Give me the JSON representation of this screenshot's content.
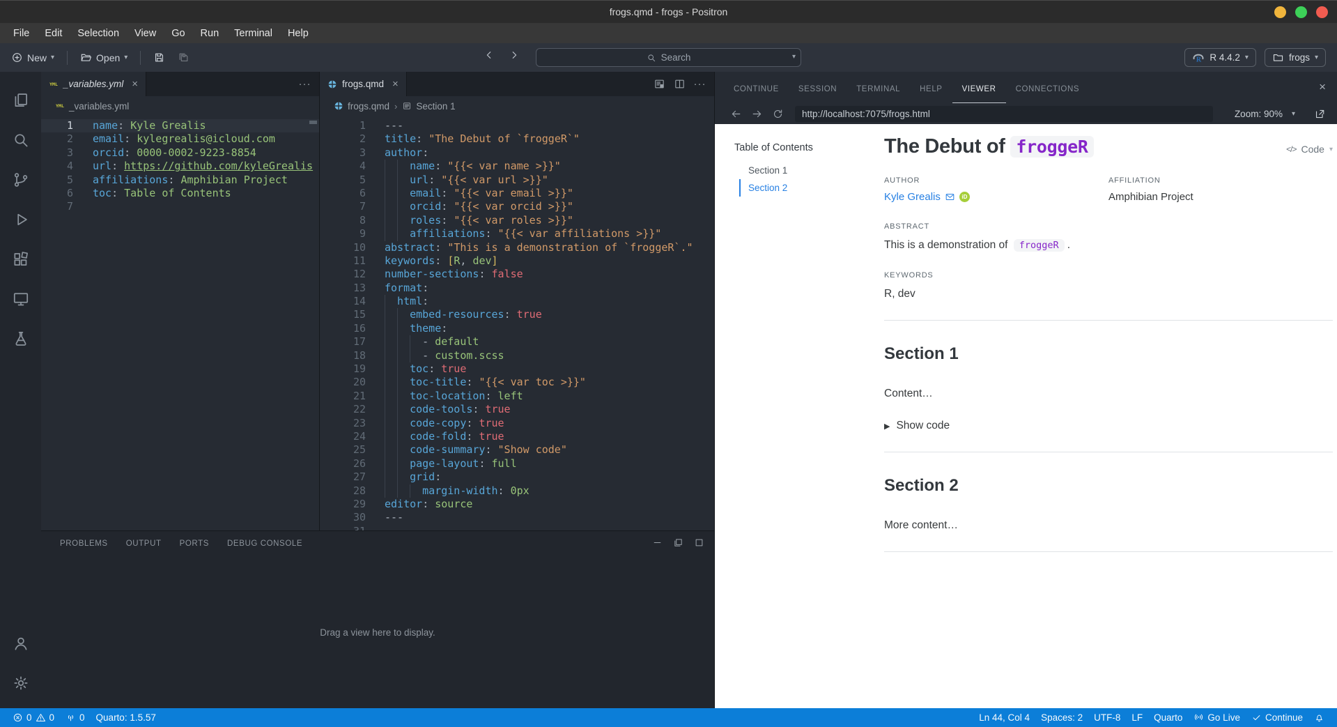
{
  "window": {
    "title": "frogs.qmd - frogs - Positron"
  },
  "menu": {
    "items": [
      "File",
      "Edit",
      "Selection",
      "View",
      "Go",
      "Run",
      "Terminal",
      "Help"
    ]
  },
  "toolbar": {
    "new_label": "New",
    "open_label": "Open",
    "search_placeholder": "Search",
    "r_version": "R 4.4.2",
    "project_name": "frogs"
  },
  "activity_bar": {
    "top": [
      "explorer-icon",
      "search-icon",
      "source-control-icon",
      "run-debug-icon",
      "extensions-icon",
      "sessions-icon",
      "testing-icon"
    ],
    "bottom": [
      "account-icon",
      "settings-gear-icon"
    ]
  },
  "left_editor": {
    "tab": {
      "label": "_variables.yml",
      "icon": "yml-icon",
      "preview": true
    },
    "actions": [
      "more-icon"
    ],
    "breadcrumb": [
      {
        "icon": "yml-icon",
        "label": "_variables.yml"
      }
    ],
    "lines": [
      {
        "n": 1,
        "i": 0,
        "current": true,
        "t": [
          [
            "key",
            "name"
          ],
          [
            "pun",
            ": "
          ],
          [
            "val",
            "Kyle Grealis"
          ]
        ]
      },
      {
        "n": 2,
        "i": 0,
        "t": [
          [
            "key",
            "email"
          ],
          [
            "pun",
            ": "
          ],
          [
            "val",
            "kylegrealis@icloud.com"
          ]
        ]
      },
      {
        "n": 3,
        "i": 0,
        "t": [
          [
            "key",
            "orcid"
          ],
          [
            "pun",
            ": "
          ],
          [
            "val",
            "0000-0002-9223-8854"
          ]
        ]
      },
      {
        "n": 4,
        "i": 0,
        "t": [
          [
            "key",
            "url"
          ],
          [
            "pun",
            ": "
          ],
          [
            "link",
            "https://github.com/kyleGrealis"
          ]
        ]
      },
      {
        "n": 5,
        "i": 0,
        "t": [
          [
            "key",
            "affiliations"
          ],
          [
            "pun",
            ": "
          ],
          [
            "val",
            "Amphibian Project"
          ]
        ]
      },
      {
        "n": 6,
        "i": 0,
        "t": [
          [
            "key",
            "toc"
          ],
          [
            "pun",
            ": "
          ],
          [
            "val",
            "Table of Contents"
          ]
        ]
      },
      {
        "n": 7,
        "i": 0,
        "t": []
      }
    ]
  },
  "right_editor": {
    "tab": {
      "label": "frogs.qmd",
      "icon": "quarto-icon",
      "preview": false
    },
    "actions": [
      "preview-icon",
      "split-icon",
      "more-icon"
    ],
    "breadcrumb": [
      {
        "icon": "quarto-icon",
        "label": "frogs.qmd"
      },
      {
        "icon": "section-icon",
        "label": "Section 1"
      }
    ],
    "lines": [
      {
        "n": 1,
        "i": 0,
        "t": [
          [
            "meta",
            "---"
          ]
        ]
      },
      {
        "n": 2,
        "i": 0,
        "t": [
          [
            "key",
            "title"
          ],
          [
            "pun",
            ": "
          ],
          [
            "str",
            "\"The Debut of `froggeR`\""
          ]
        ]
      },
      {
        "n": 3,
        "i": 0,
        "t": [
          [
            "key",
            "author"
          ],
          [
            "pun",
            ":"
          ]
        ]
      },
      {
        "n": 4,
        "i": 2,
        "t": [
          [
            "key",
            "name"
          ],
          [
            "pun",
            ": "
          ],
          [
            "str",
            "\"{{< var name >}}\""
          ]
        ]
      },
      {
        "n": 5,
        "i": 2,
        "t": [
          [
            "key",
            "url"
          ],
          [
            "pun",
            ": "
          ],
          [
            "str",
            "\"{{< var url >}}\""
          ]
        ]
      },
      {
        "n": 6,
        "i": 2,
        "t": [
          [
            "key",
            "email"
          ],
          [
            "pun",
            ": "
          ],
          [
            "str",
            "\"{{< var email >}}\""
          ]
        ]
      },
      {
        "n": 7,
        "i": 2,
        "t": [
          [
            "key",
            "orcid"
          ],
          [
            "pun",
            ": "
          ],
          [
            "str",
            "\"{{< var orcid >}}\""
          ]
        ]
      },
      {
        "n": 8,
        "i": 2,
        "t": [
          [
            "key",
            "roles"
          ],
          [
            "pun",
            ": "
          ],
          [
            "str",
            "\"{{< var roles >}}\""
          ]
        ]
      },
      {
        "n": 9,
        "i": 2,
        "t": [
          [
            "key",
            "affiliations"
          ],
          [
            "pun",
            ": "
          ],
          [
            "str",
            "\"{{< var affiliations >}}\""
          ]
        ]
      },
      {
        "n": 10,
        "i": 0,
        "t": [
          [
            "key",
            "abstract"
          ],
          [
            "pun",
            ": "
          ],
          [
            "str",
            "\"This is a demonstration of `froggeR`.\""
          ]
        ]
      },
      {
        "n": 11,
        "i": 0,
        "t": [
          [
            "key",
            "keywords"
          ],
          [
            "pun",
            ": "
          ],
          [
            "brk",
            "["
          ],
          [
            "val",
            "R"
          ],
          [
            "pun",
            ", "
          ],
          [
            "val",
            "dev"
          ],
          [
            "brk",
            "]"
          ]
        ]
      },
      {
        "n": 12,
        "i": 0,
        "t": [
          [
            "key",
            "number-sections"
          ],
          [
            "pun",
            ": "
          ],
          [
            "bool",
            "false"
          ]
        ]
      },
      {
        "n": 13,
        "i": 0,
        "t": [
          [
            "key",
            "format"
          ],
          [
            "pun",
            ":"
          ]
        ]
      },
      {
        "n": 14,
        "i": 1,
        "t": [
          [
            "key",
            "html"
          ],
          [
            "pun",
            ":"
          ]
        ]
      },
      {
        "n": 15,
        "i": 2,
        "t": [
          [
            "key",
            "embed-resources"
          ],
          [
            "pun",
            ": "
          ],
          [
            "bool",
            "true"
          ]
        ]
      },
      {
        "n": 16,
        "i": 2,
        "t": [
          [
            "key",
            "theme"
          ],
          [
            "pun",
            ":"
          ]
        ]
      },
      {
        "n": 17,
        "i": 3,
        "t": [
          [
            "pun",
            "- "
          ],
          [
            "val",
            "default"
          ]
        ]
      },
      {
        "n": 18,
        "i": 3,
        "t": [
          [
            "pun",
            "- "
          ],
          [
            "val",
            "custom.scss"
          ]
        ]
      },
      {
        "n": 19,
        "i": 2,
        "t": [
          [
            "key",
            "toc"
          ],
          [
            "pun",
            ": "
          ],
          [
            "bool",
            "true"
          ]
        ]
      },
      {
        "n": 20,
        "i": 2,
        "t": [
          [
            "key",
            "toc-title"
          ],
          [
            "pun",
            ": "
          ],
          [
            "str",
            "\"{{< var toc >}}\""
          ]
        ]
      },
      {
        "n": 21,
        "i": 2,
        "t": [
          [
            "key",
            "toc-location"
          ],
          [
            "pun",
            ": "
          ],
          [
            "val",
            "left"
          ]
        ]
      },
      {
        "n": 22,
        "i": 2,
        "t": [
          [
            "key",
            "code-tools"
          ],
          [
            "pun",
            ": "
          ],
          [
            "bool",
            "true"
          ]
        ]
      },
      {
        "n": 23,
        "i": 2,
        "t": [
          [
            "key",
            "code-copy"
          ],
          [
            "pun",
            ": "
          ],
          [
            "bool",
            "true"
          ]
        ]
      },
      {
        "n": 24,
        "i": 2,
        "t": [
          [
            "key",
            "code-fold"
          ],
          [
            "pun",
            ": "
          ],
          [
            "bool",
            "true"
          ]
        ]
      },
      {
        "n": 25,
        "i": 2,
        "t": [
          [
            "key",
            "code-summary"
          ],
          [
            "pun",
            ": "
          ],
          [
            "str",
            "\"Show code\""
          ]
        ]
      },
      {
        "n": 26,
        "i": 2,
        "t": [
          [
            "key",
            "page-layout"
          ],
          [
            "pun",
            ": "
          ],
          [
            "val",
            "full"
          ]
        ]
      },
      {
        "n": 27,
        "i": 2,
        "t": [
          [
            "key",
            "grid"
          ],
          [
            "pun",
            ":"
          ]
        ]
      },
      {
        "n": 28,
        "i": 3,
        "t": [
          [
            "key",
            "margin-width"
          ],
          [
            "pun",
            ": "
          ],
          [
            "val",
            "0px"
          ]
        ]
      },
      {
        "n": 29,
        "i": 0,
        "t": [
          [
            "key",
            "editor"
          ],
          [
            "pun",
            ": "
          ],
          [
            "val",
            "source"
          ]
        ]
      },
      {
        "n": 30,
        "i": 0,
        "t": [
          [
            "meta",
            "---"
          ]
        ]
      },
      {
        "n": 31,
        "i": 0,
        "t": []
      }
    ]
  },
  "bottom_panel": {
    "tabs": [
      "PROBLEMS",
      "OUTPUT",
      "PORTS",
      "DEBUG CONSOLE"
    ],
    "empty_text": "Drag a view here to display."
  },
  "right_panel": {
    "tabs": [
      "CONTINUE",
      "SESSION",
      "TERMINAL",
      "HELP",
      "VIEWER",
      "CONNECTIONS"
    ],
    "active_tab": "VIEWER",
    "url": "http://localhost:7075/frogs.html",
    "zoom_label": "Zoom: 90%"
  },
  "viewer": {
    "toc_title": "Table of Contents",
    "toc_items": [
      {
        "label": "Section 1",
        "active": false
      },
      {
        "label": "Section 2",
        "active": true
      }
    ],
    "title_prefix": "The Debut of ",
    "title_code": "froggeR",
    "code_button": "Code",
    "author_label": "AUTHOR",
    "author": "Kyle Grealis",
    "affiliation_label": "AFFILIATION",
    "affiliation": "Amphibian Project",
    "abstract_label": "ABSTRACT",
    "abstract_prefix": "This is a demonstration of ",
    "abstract_code": "froggeR",
    "abstract_suffix": ".",
    "keywords_label": "KEYWORDS",
    "keywords": "R, dev",
    "section1_title": "Section 1",
    "section1_content": "Content…",
    "show_code_label": "Show code",
    "section2_title": "Section 2",
    "section2_content": "More content…"
  },
  "status_bar": {
    "errors": "0",
    "warnings": "0",
    "ports": "0",
    "quarto_build": "Quarto: 1.5.57",
    "line_col": "Ln 44, Col 4",
    "indent": "Spaces: 2",
    "encoding": "UTF-8",
    "eol": "LF",
    "language": "Quarto",
    "go_live": "Go Live",
    "continue_label": "Continue"
  },
  "colors": {
    "status_bar": "#0c7ed8",
    "accent_blue": "#2780e3",
    "code_purple": "#8626c9",
    "orcid_green": "#a6ce39",
    "window_yellow": "#f0b53c",
    "window_green": "#3dd158",
    "window_red": "#f25c50"
  }
}
